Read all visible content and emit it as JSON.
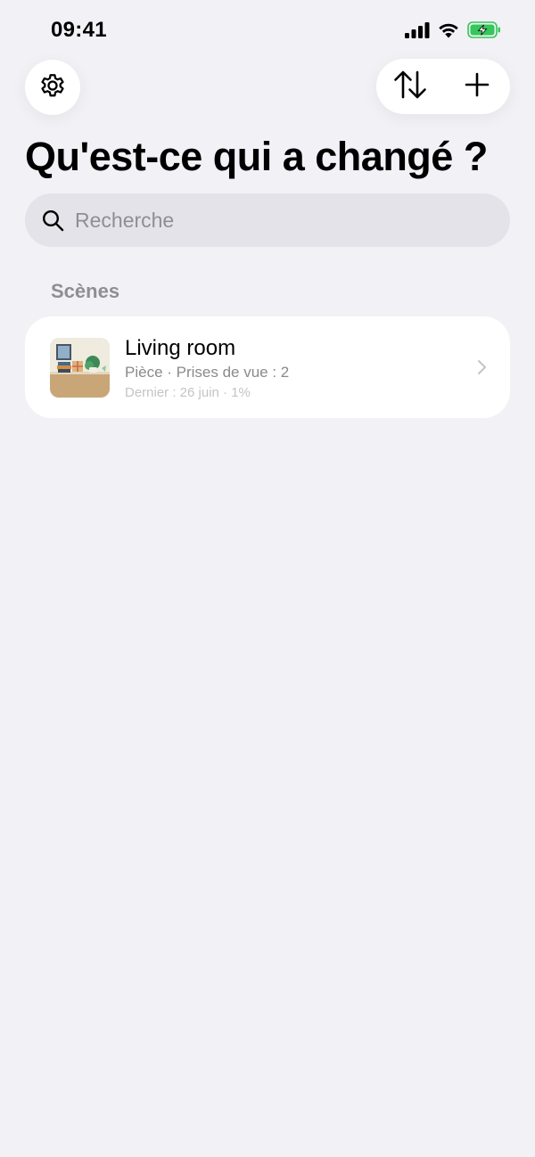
{
  "status_bar": {
    "time": "09:41",
    "icons": [
      "signal-icon",
      "wifi-icon",
      "battery-charging-icon"
    ],
    "battery_color": "#34c759"
  },
  "toolbar": {
    "icons": [
      "gear-icon",
      "sort-arrows-icon",
      "plus-icon"
    ]
  },
  "page": {
    "title": "Qu'est-ce qui a changé ?"
  },
  "search": {
    "placeholder": "Recherche",
    "value": ""
  },
  "sections": [
    {
      "header": "Scènes",
      "items": [
        {
          "title": "Living room",
          "meta": "Pièce · Prises de vue : 2",
          "last": "Dernier : 26 juin · 1%",
          "thumbnail_icon": "living-room-thumbnail"
        }
      ]
    }
  ],
  "colors": {
    "background": "#f2f1f6",
    "card": "#ffffff",
    "search_field": "#e4e3e9",
    "secondary_text": "#8e8e93"
  }
}
